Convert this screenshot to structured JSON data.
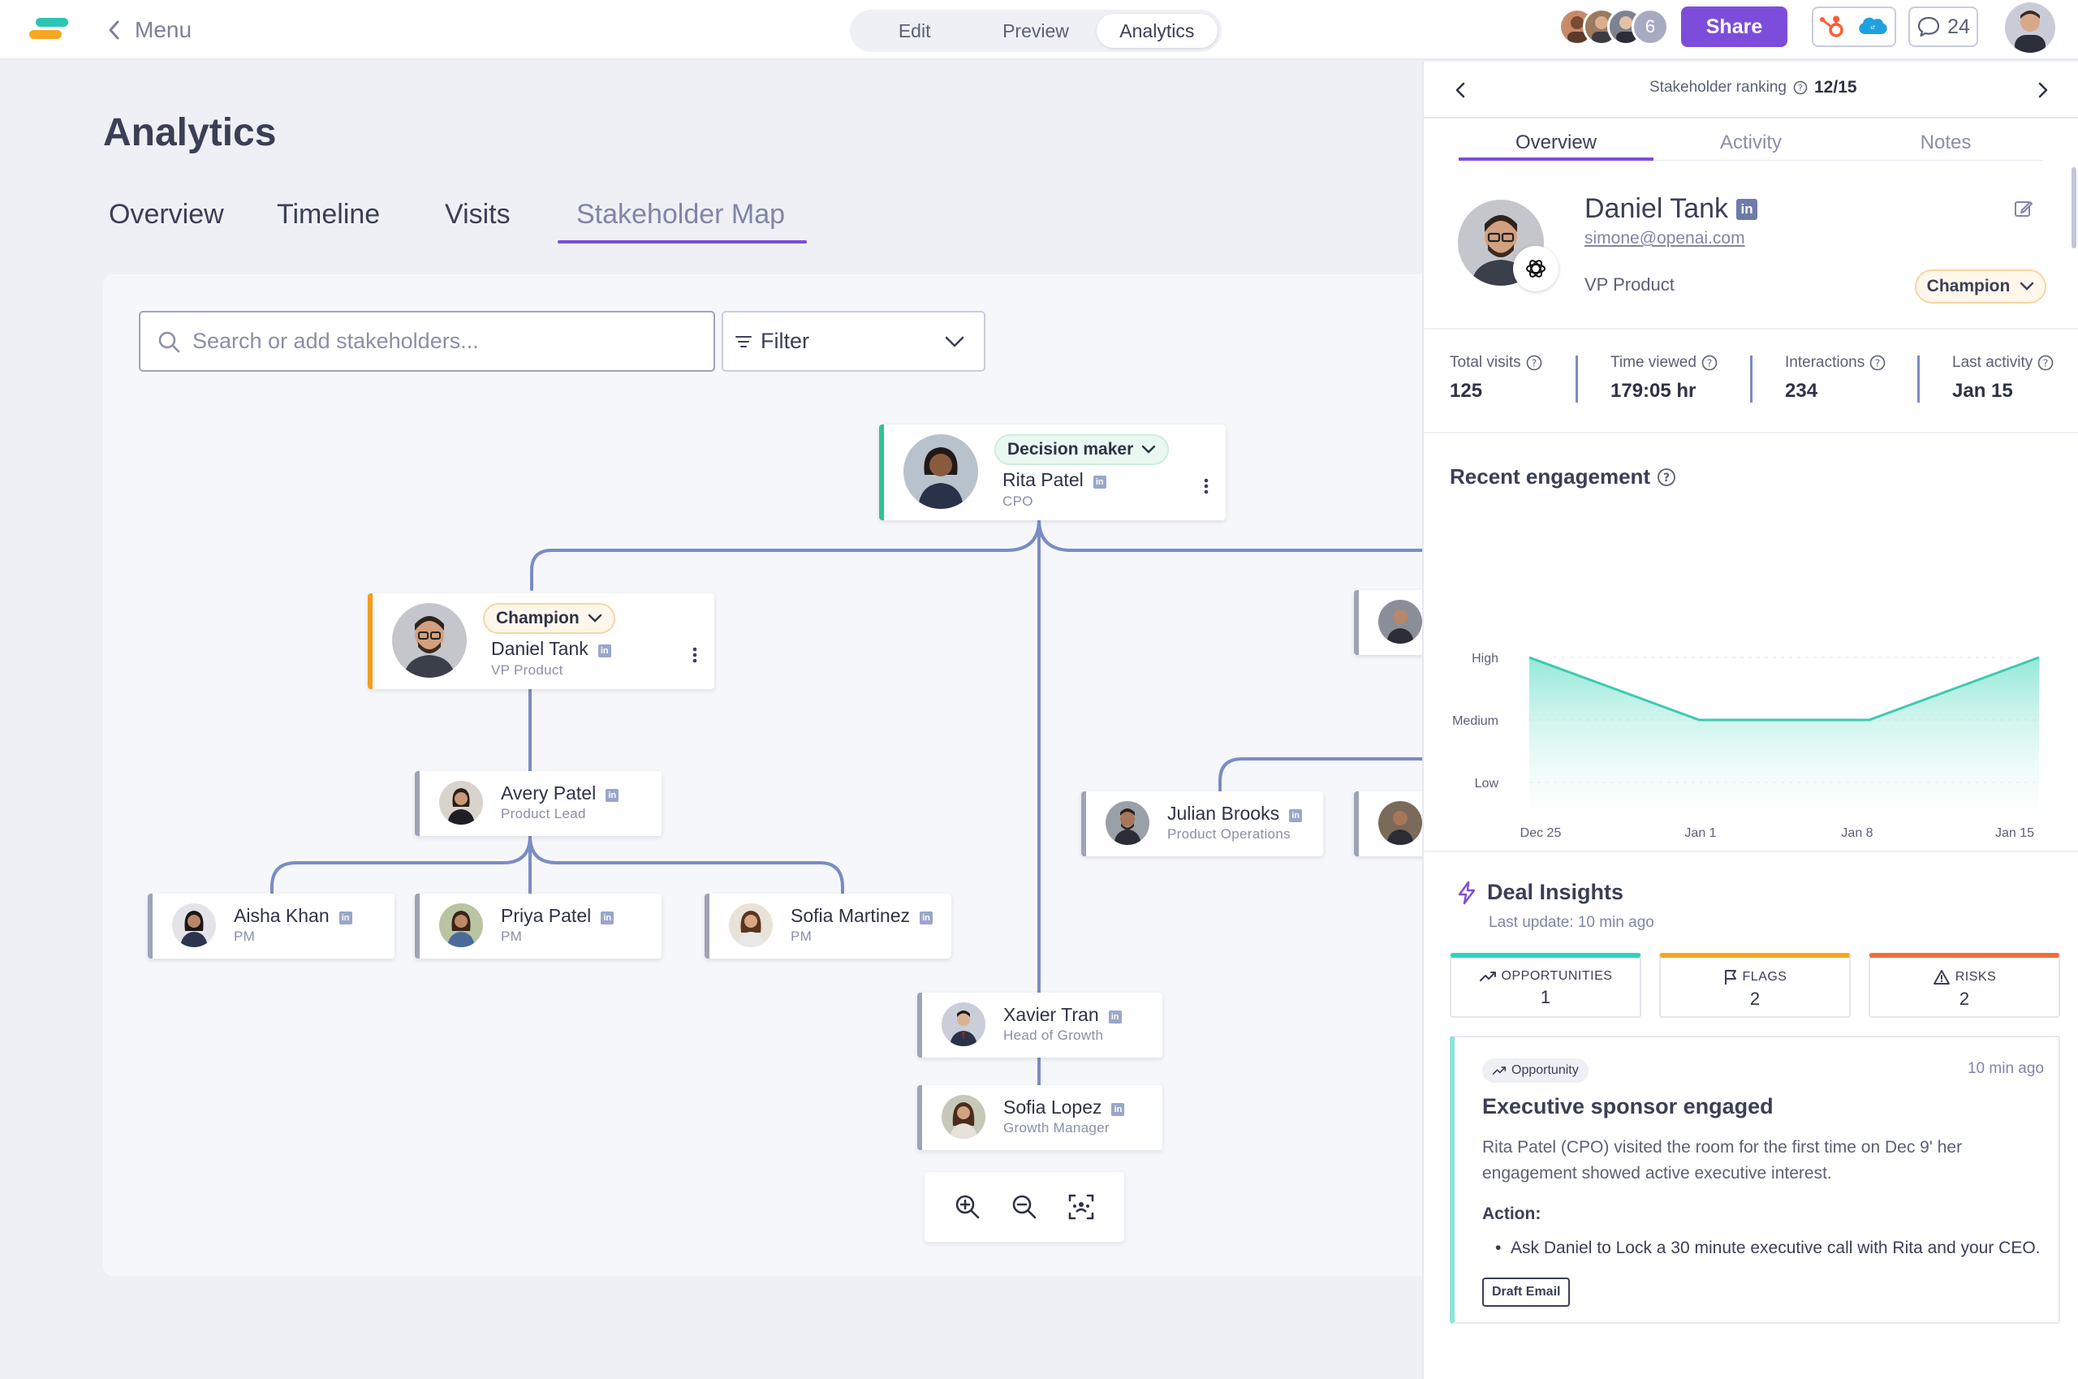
{
  "topbar": {
    "back_label": "Menu",
    "modes": [
      "Edit",
      "Preview",
      "Analytics"
    ],
    "active_mode": "Analytics",
    "collaborator_extra_count": "6",
    "share_label": "Share",
    "comments_count": "24"
  },
  "page": {
    "title": "Analytics",
    "tabs": [
      "Overview",
      "Timeline",
      "Visits",
      "Stakeholder Map"
    ],
    "active_tab": "Stakeholder Map"
  },
  "map": {
    "search_placeholder": "Search or add stakeholders...",
    "filter_label": "Filter",
    "nodes": {
      "rita": {
        "badge": "Decision maker",
        "name": "Rita Patel",
        "role": "CPO"
      },
      "daniel": {
        "badge": "Champion",
        "name": "Daniel Tank",
        "role": "VP Product"
      },
      "avery": {
        "name": "Avery Patel",
        "role": "Product Lead"
      },
      "aisha": {
        "name": "Aisha Khan",
        "role": "PM"
      },
      "priya": {
        "name": "Priya Patel",
        "role": "PM"
      },
      "sofia_m": {
        "name": "Sofia Martinez",
        "role": "PM"
      },
      "julian": {
        "name": "Julian Brooks",
        "role": "Product Operations"
      },
      "xavier": {
        "name": "Xavier Tran",
        "role": "Head of Growth"
      },
      "sofia_l": {
        "name": "Sofia Lopez",
        "role": "Growth Manager"
      }
    }
  },
  "panel": {
    "ranking_label": "Stakeholder ranking",
    "ranking_value": "12/15",
    "tabs": [
      "Overview",
      "Activity",
      "Notes"
    ],
    "active_tab": "Overview",
    "profile": {
      "name": "Daniel Tank",
      "email": "simone@openai.com",
      "role": "VP Product",
      "status": "Champion"
    },
    "stats": [
      {
        "label": "Total visits",
        "value": "125"
      },
      {
        "label": "Time viewed",
        "value": "179:05 hr"
      },
      {
        "label": "Interactions",
        "value": "234"
      },
      {
        "label": "Last activity",
        "value": "Jan 15"
      }
    ],
    "engagement_title": "Recent engagement",
    "deal_insights": {
      "title": "Deal Insights",
      "updated": "Last update: 10 min ago",
      "kpis": [
        {
          "label": "OPPORTUNITIES",
          "value": "1",
          "color": "#2dd4bf"
        },
        {
          "label": "FLAGS",
          "value": "2",
          "color": "#f5a623"
        },
        {
          "label": "RISKS",
          "value": "2",
          "color": "#f26b3a"
        }
      ],
      "card": {
        "tag": "Opportunity",
        "time": "10 min ago",
        "title": "Executive sponsor engaged",
        "body": "Rita Patel (CPO) visited the room for the first time on Dec 9' her engagement showed active executive interest.",
        "action_label": "Action:",
        "action_item": "Ask Daniel to Lock a 30 minute executive call with Rita and your CEO.",
        "button": "Draft Email"
      }
    }
  },
  "chart_data": {
    "type": "area",
    "x": [
      "Dec 25",
      "Jan 1",
      "Jan 8",
      "Jan 15"
    ],
    "y_categories": [
      "Low",
      "Medium",
      "High"
    ],
    "values": [
      "High",
      "Medium",
      "Medium",
      "High"
    ],
    "series_color": "#3ec9b0",
    "grid": true
  },
  "colors": {
    "accent": "#7c4ddb",
    "decision_maker_border": "#2fc48d",
    "champion_border": "#f59c1a"
  }
}
